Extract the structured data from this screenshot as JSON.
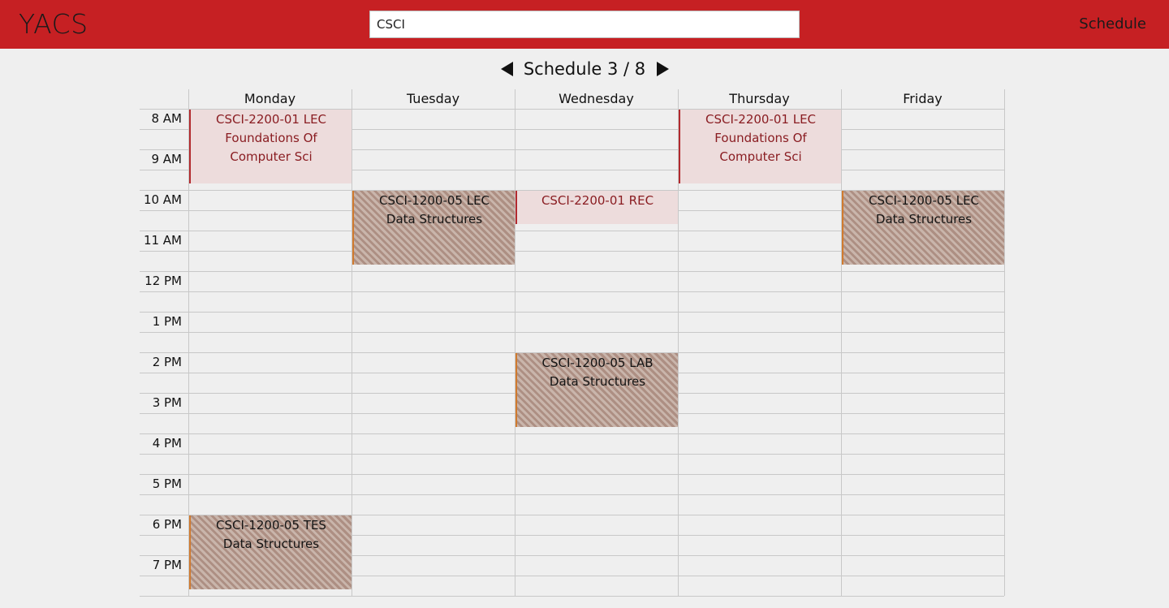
{
  "header": {
    "logo": "YACS",
    "search_value": "CSCI",
    "nav_schedule": "Schedule"
  },
  "pager": {
    "label": "Schedule 3 / 8"
  },
  "days": [
    "Monday",
    "Tuesday",
    "Wednesday",
    "Thursday",
    "Friday"
  ],
  "hours": [
    "8 AM",
    "9 AM",
    "10 AM",
    "11 AM",
    "12 PM",
    "1 PM",
    "2 PM",
    "3 PM",
    "4 PM",
    "5 PM",
    "6 PM",
    "7 PM"
  ],
  "events": [
    {
      "day": 0,
      "start": 8,
      "end": 9.83,
      "style": "pink",
      "line1": "CSCI-2200-01 LEC",
      "line2": "Foundations Of Computer Sci"
    },
    {
      "day": 3,
      "start": 8,
      "end": 9.83,
      "style": "pink",
      "line1": "CSCI-2200-01 LEC",
      "line2": "Foundations Of Computer Sci"
    },
    {
      "day": 1,
      "start": 10,
      "end": 11.83,
      "style": "striped",
      "line1": "CSCI-1200-05 LEC",
      "line2": "Data Structures"
    },
    {
      "day": 4,
      "start": 10,
      "end": 11.83,
      "style": "striped",
      "line1": "CSCI-1200-05 LEC",
      "line2": "Data Structures"
    },
    {
      "day": 2,
      "start": 10,
      "end": 10.83,
      "style": "pink",
      "line1": "CSCI-2200-01 REC",
      "line2": ""
    },
    {
      "day": 2,
      "start": 14,
      "end": 15.83,
      "style": "striped",
      "line1": "CSCI-1200-05 LAB",
      "line2": "Data Structures"
    },
    {
      "day": 0,
      "start": 18,
      "end": 19.83,
      "style": "striped",
      "line1": "CSCI-1200-05 TES",
      "line2": "Data Structures"
    }
  ]
}
